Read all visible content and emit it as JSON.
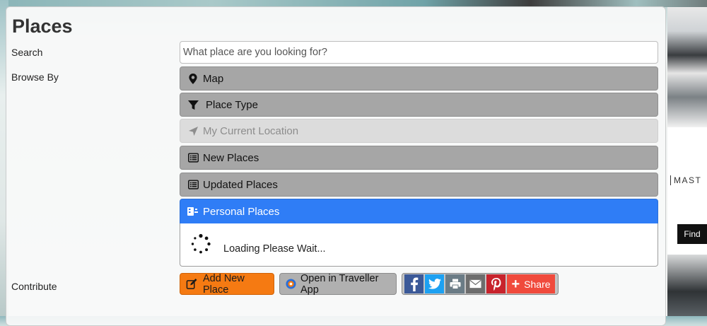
{
  "page": {
    "title": "Places"
  },
  "search": {
    "label": "Search",
    "placeholder": "What place are you looking for?"
  },
  "browse": {
    "label": "Browse By",
    "items": [
      {
        "label": "Map",
        "icon": "map-marker-icon",
        "state": "default"
      },
      {
        "label": "Place Type",
        "icon": "filter-icon",
        "state": "default"
      },
      {
        "label": "My Current Location",
        "icon": "location-arrow-icon",
        "state": "disabled"
      },
      {
        "label": "New Places",
        "icon": "list-icon",
        "state": "default"
      },
      {
        "label": "Updated Places",
        "icon": "list-icon",
        "state": "default"
      },
      {
        "label": "Personal Places",
        "icon": "personal-places-icon",
        "state": "active"
      }
    ],
    "loading_text": "Loading Please Wait..."
  },
  "contribute": {
    "label": "Contribute",
    "add_label": "Add New Place",
    "app_label": "Open in Traveller App",
    "share_label": "Share"
  },
  "ad": {
    "brand_text": "MAST",
    "button_label": "Find"
  },
  "colors": {
    "active": "#2f7df6",
    "add": "#f57a12",
    "browse": "#a6a6a6"
  }
}
